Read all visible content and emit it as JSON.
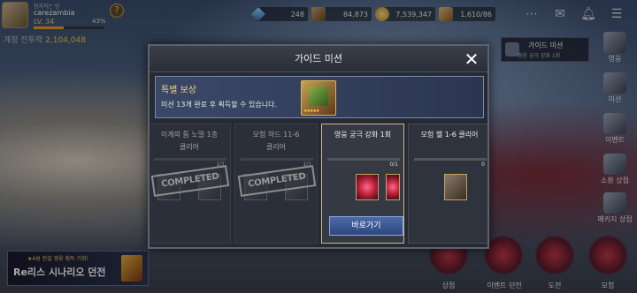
{
  "player": {
    "title": "잠자지는 밤",
    "name": "carezambia",
    "level": "LV. 34",
    "xp_percent": "43%",
    "xp_fraction": 0.43
  },
  "currencies": [
    "248",
    "84,873",
    "7,539,347",
    "1,610/86"
  ],
  "power": {
    "label": "계정 전투력",
    "value": "2,104,048"
  },
  "guide_panel": {
    "title": "가이드 미션",
    "subtitle": "영웅 궁극 강화 1회"
  },
  "side_menu": [
    "영웅",
    "미션",
    "이벤트",
    "소환 상점",
    "패키지 상점"
  ],
  "banner": {
    "line1": "★4성 전설 영웅 획득 기회!",
    "line2": "Re리스 시나리오 던전"
  },
  "bottom_menu": [
    "상점",
    "이벤트 던전",
    "도전",
    "모험"
  ],
  "dialog": {
    "title": "가이드 미션",
    "reward_title": "특별 보상",
    "reward_desc": "미션 13개 완료 후 획득할 수 있습니다.",
    "reward_stars": "★★★★★",
    "cards": [
      {
        "title": "이계의 틈 노멀 1층",
        "title2": "클리어",
        "progress": "1/1",
        "stamp": "COMPLETED",
        "state": "done"
      },
      {
        "title": "모험 하드 11-6",
        "title2": "클리어",
        "progress": "1/1",
        "stamp": "COMPLETED",
        "state": "done"
      },
      {
        "title": "영웅 궁극 강화 1회",
        "title2": "",
        "progress": "0/1",
        "button": "바로가기",
        "state": "active"
      },
      {
        "title": "모험 헬 1-6 클리어",
        "title2": "",
        "progress": "0",
        "state": "pending"
      }
    ]
  }
}
